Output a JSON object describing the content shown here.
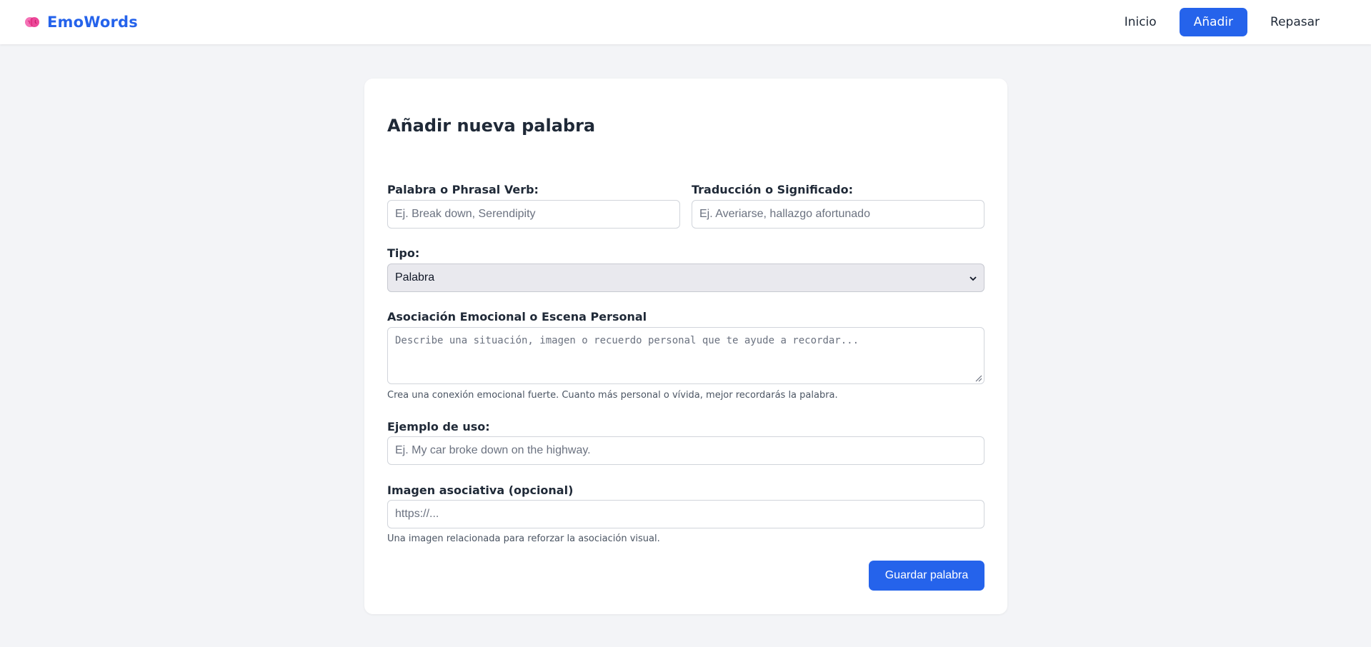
{
  "navbar": {
    "brand": "EmoWords",
    "links": [
      "Inicio",
      "Añadir",
      "Repasar"
    ],
    "active": "Añadir"
  },
  "form": {
    "title": "Añadir nueva palabra",
    "word": {
      "label": "Palabra o Phrasal Verb:",
      "placeholder": "Ej. Break down, Serendipity",
      "value": ""
    },
    "translation": {
      "label": "Traducción o Significado:",
      "placeholder": "Ej. Averiarse, hallazgo afortunado",
      "value": ""
    },
    "type": {
      "label": "Tipo:",
      "selected": "Palabra"
    },
    "emotion": {
      "label": "Asociación Emocional o Escena Personal",
      "placeholder": "Describe una situación, imagen o recuerdo personal que te ayude a recordar...",
      "help": "Crea una conexión emocional fuerte. Cuanto más personal o vívida, mejor recordarás la palabra."
    },
    "example": {
      "label": "Ejemplo de uso:",
      "placeholder": "Ej. My car broke down on the highway.",
      "value": ""
    },
    "image": {
      "label": "Imagen asociativa (opcional)",
      "placeholder": "https://...",
      "help": "Una imagen relacionada para reforzar la asociación visual."
    },
    "submit_label": "Guardar palabra"
  },
  "colors": {
    "accent": "#2563eb",
    "brain": "#f472b6",
    "background": "#f3f4f7"
  },
  "icons": {
    "brand": "brain-icon",
    "select": "chevron-down-icon"
  }
}
